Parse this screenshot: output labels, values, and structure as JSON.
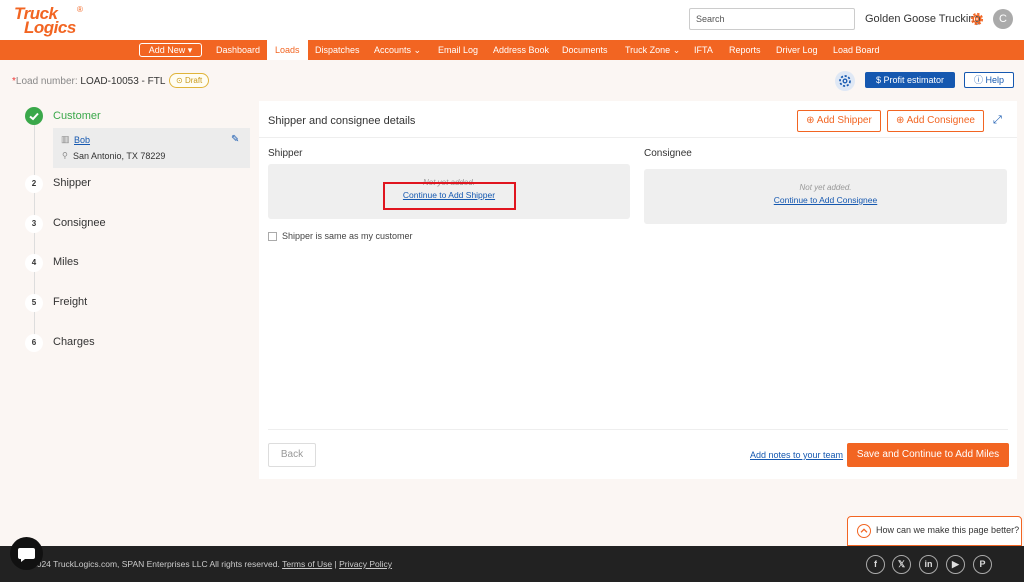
{
  "header": {
    "logo_line1": "Truck",
    "logo_line2": "Logics",
    "logo_reg": "®",
    "search_placeholder": "Search",
    "company": "Golden Goose Trucking",
    "avatar_letter": "C"
  },
  "nav": {
    "add_new": "Add New",
    "items": [
      "Dashboard",
      "Loads",
      "Dispatches",
      "Accounts",
      "Email Log",
      "Address Book",
      "Documents",
      "Truck Zone",
      "IFTA",
      "Reports",
      "Driver Log",
      "Load Board"
    ],
    "active": "Loads"
  },
  "load": {
    "required_mark": "*",
    "label": "Load number:",
    "number": "LOAD-10053 - FTL",
    "status": "Draft"
  },
  "toolbar": {
    "profit": "$ Profit estimator",
    "help": "Help"
  },
  "steps": [
    {
      "num": "",
      "label": "Customer",
      "state": "complete"
    },
    {
      "num": "2",
      "label": "Shipper"
    },
    {
      "num": "3",
      "label": "Consignee"
    },
    {
      "num": "4",
      "label": "Miles"
    },
    {
      "num": "5",
      "label": "Freight"
    },
    {
      "num": "6",
      "label": "Charges"
    }
  ],
  "customer": {
    "name": "Bob",
    "address": "San Antonio, TX 78229"
  },
  "card": {
    "title": "Shipper and consignee details",
    "add_shipper": "Add Shipper",
    "add_consignee": "Add Consignee",
    "shipper_label": "Shipper",
    "consignee_label": "Consignee",
    "shipper_empty": "Not yet added.",
    "shipper_link": "Continue to Add Shipper",
    "consignee_empty": "Not yet added.",
    "consignee_link": "Continue to Add Consignee",
    "same_as_customer": "Shipper is same as my customer",
    "back": "Back",
    "notes": "Add notes to your team",
    "save": "Save and Continue to Add Miles"
  },
  "feedback": {
    "text": "How can we make this page better?"
  },
  "footer": {
    "copyright": "2024 TruckLogics.com, SPAN Enterprises LLC All rights reserved.",
    "terms": "Terms of Use",
    "separator": "|",
    "privacy": "Privacy Policy",
    "social": [
      "facebook",
      "x",
      "linkedin",
      "youtube",
      "pinterest"
    ]
  },
  "colors": {
    "brand": "#f26522",
    "link": "#1558b0",
    "success": "#3aa84a",
    "highlight": "#e0151f"
  }
}
